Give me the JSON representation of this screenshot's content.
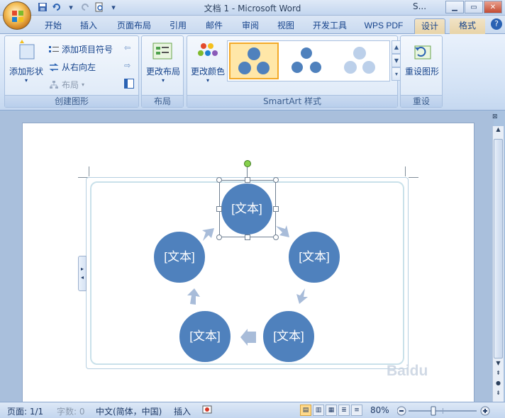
{
  "window": {
    "title": "文档 1 - Microsoft Word",
    "context_title": "S..."
  },
  "tabs": [
    {
      "label": "开始",
      "active": false
    },
    {
      "label": "插入",
      "active": false
    },
    {
      "label": "页面布局",
      "active": false
    },
    {
      "label": "引用",
      "active": false
    },
    {
      "label": "邮件",
      "active": false
    },
    {
      "label": "审阅",
      "active": false
    },
    {
      "label": "视图",
      "active": false
    },
    {
      "label": "开发工具",
      "active": false
    },
    {
      "label": "WPS PDF",
      "active": false
    },
    {
      "label": "设计",
      "active": true
    },
    {
      "label": "格式",
      "active": false
    }
  ],
  "ribbon": {
    "create_group": {
      "label": "创建图形",
      "add_shape": "添加形状",
      "add_bullet": "添加项目符号",
      "right_to_left": "从右向左",
      "layout": "布局"
    },
    "layout_group": {
      "label": "布局",
      "change_layout": "更改布局"
    },
    "styles_group": {
      "label": "SmartArt 样式",
      "change_colors": "更改颜色"
    },
    "reset_group": {
      "label": "重设",
      "reset_graphic": "重设图形"
    }
  },
  "smartart": {
    "nodes": [
      "[文本]",
      "[文本]",
      "[文本]",
      "[文本]",
      "[文本]"
    ],
    "node_color": "#4f81bd",
    "arrow_color": "#a8bcd9"
  },
  "statusbar": {
    "page": "页面: 1/1",
    "words": "字数: 0",
    "language": "中文(简体，中国)",
    "mode": "插入",
    "zoom": "80%"
  },
  "watermark": "Baidu"
}
